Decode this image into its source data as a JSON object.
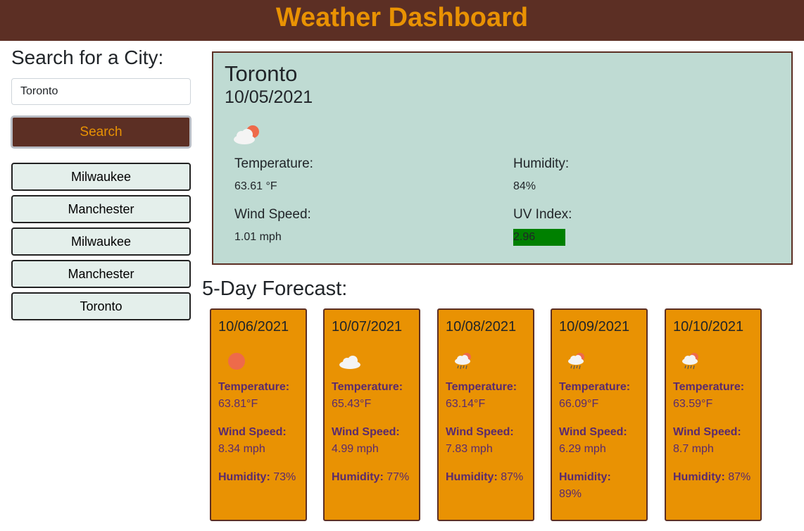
{
  "header": {
    "title": "Weather Dashboard"
  },
  "sidebar": {
    "heading": "Search for a City:",
    "search_value": "Toronto",
    "search_button": "Search",
    "history": [
      "Milwaukee",
      "Manchester",
      "Milwaukee",
      "Manchester",
      "Toronto"
    ]
  },
  "current": {
    "city": "Toronto",
    "date": "10/05/2021",
    "icon": "partly-cloudy-icon",
    "temperature_label": "Temperature:",
    "temperature_value": "63.61 °F",
    "humidity_label": "Humidity:",
    "humidity_value": "84%",
    "wind_label": "Wind Speed:",
    "wind_value": "1.01 mph",
    "uv_label": "UV Index:",
    "uv_value": "2.96",
    "uv_color": "#008000"
  },
  "forecast": {
    "title": "5-Day Forecast:",
    "temp_label": "Temperature:",
    "wind_label": "Wind Speed:",
    "humidity_label": "Humidity:",
    "days": [
      {
        "date": "10/06/2021",
        "icon": "sun-icon",
        "temp": "63.81°F",
        "wind": "8.34 mph",
        "humidity": "73%"
      },
      {
        "date": "10/07/2021",
        "icon": "cloud-icon",
        "temp": "65.43°F",
        "wind": "4.99 mph",
        "humidity": "77%"
      },
      {
        "date": "10/08/2021",
        "icon": "rain-icon",
        "temp": "63.14°F",
        "wind": "7.83 mph",
        "humidity": "87%"
      },
      {
        "date": "10/09/2021",
        "icon": "rain-icon",
        "temp": "66.09°F",
        "wind": "6.29 mph",
        "humidity": "89%"
      },
      {
        "date": "10/10/2021",
        "icon": "rain-icon",
        "temp": "63.59°F",
        "wind": "8.7 mph",
        "humidity": "87%"
      }
    ]
  },
  "colors": {
    "header_bg": "#5c2f24",
    "accent": "#e99203",
    "current_bg": "#bfdbd3",
    "history_bg": "#e4efeb",
    "forecast_text": "#5a2a6e"
  }
}
